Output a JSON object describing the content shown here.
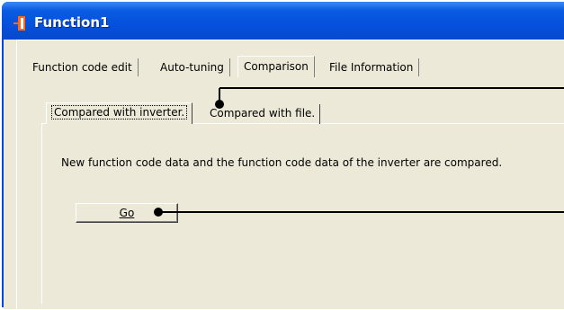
{
  "window": {
    "title": "Function1"
  },
  "tabs": [
    {
      "label": "Function code edit",
      "active": false
    },
    {
      "label": "Auto-tuning",
      "active": false
    },
    {
      "label": "Comparison",
      "active": true
    },
    {
      "label": "File Information",
      "active": false
    }
  ],
  "subtabs": [
    {
      "label": "Compared with inverter.",
      "active": true
    },
    {
      "label": "Compared with file.",
      "active": false
    }
  ],
  "comparison": {
    "description": "New function code data and the function code data of the inverter are compared.",
    "go_label": "Go"
  },
  "colors": {
    "titlebar": "#0550dc",
    "title_icon": "#ff6a1a",
    "panel": "#ece9d8",
    "callout": "#000000"
  }
}
